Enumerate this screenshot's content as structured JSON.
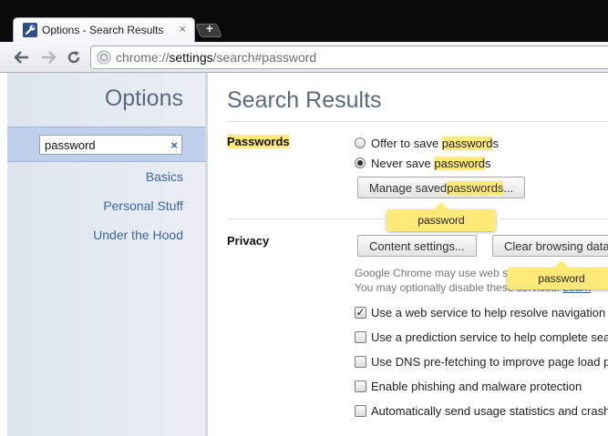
{
  "tab": {
    "title": "Options - Search Results",
    "close": "×"
  },
  "newtab": {
    "label": "+"
  },
  "toolbar": {
    "url_scheme": "chrome://",
    "url_host": "settings",
    "url_path": "/search#password"
  },
  "sidebar": {
    "title": "Options",
    "search_value": "password",
    "search_clear": "×",
    "items": [
      {
        "label": "Basics"
      },
      {
        "label": "Personal Stuff"
      },
      {
        "label": "Under the Hood"
      }
    ]
  },
  "main": {
    "title": "Search Results",
    "passwords": {
      "title": "Passwords",
      "offer_pre": "Offer to save ",
      "offer_hl": "password",
      "offer_post": "s",
      "never_pre": "Never save ",
      "never_hl": "password",
      "never_post": "s",
      "manage_pre": "Manage saved ",
      "manage_hl": "passwords",
      "manage_post": "...",
      "bubble": "password"
    },
    "privacy": {
      "title": "Privacy",
      "content_settings": "Content settings...",
      "clear_browsing": "Clear browsing data",
      "bubble": "password",
      "note1": "Google Chrome may use web services to improve",
      "note2": "You may optionally disable these services.",
      "learn_more": "Learn",
      "options": [
        {
          "label": "Use a web service to help resolve navigation errors",
          "checked": true
        },
        {
          "label": "Use a prediction service to help complete searches",
          "checked": false
        },
        {
          "label": "Use DNS pre-fetching to improve page load performance",
          "checked": false
        },
        {
          "label": "Enable phishing and malware protection",
          "checked": false
        },
        {
          "label": "Automatically send usage statistics and crash reports",
          "checked": false
        }
      ]
    }
  },
  "colors": {
    "highlight": "#ffe978",
    "link": "#3a67a8",
    "sidebar_selected": "#bfd1ea"
  }
}
